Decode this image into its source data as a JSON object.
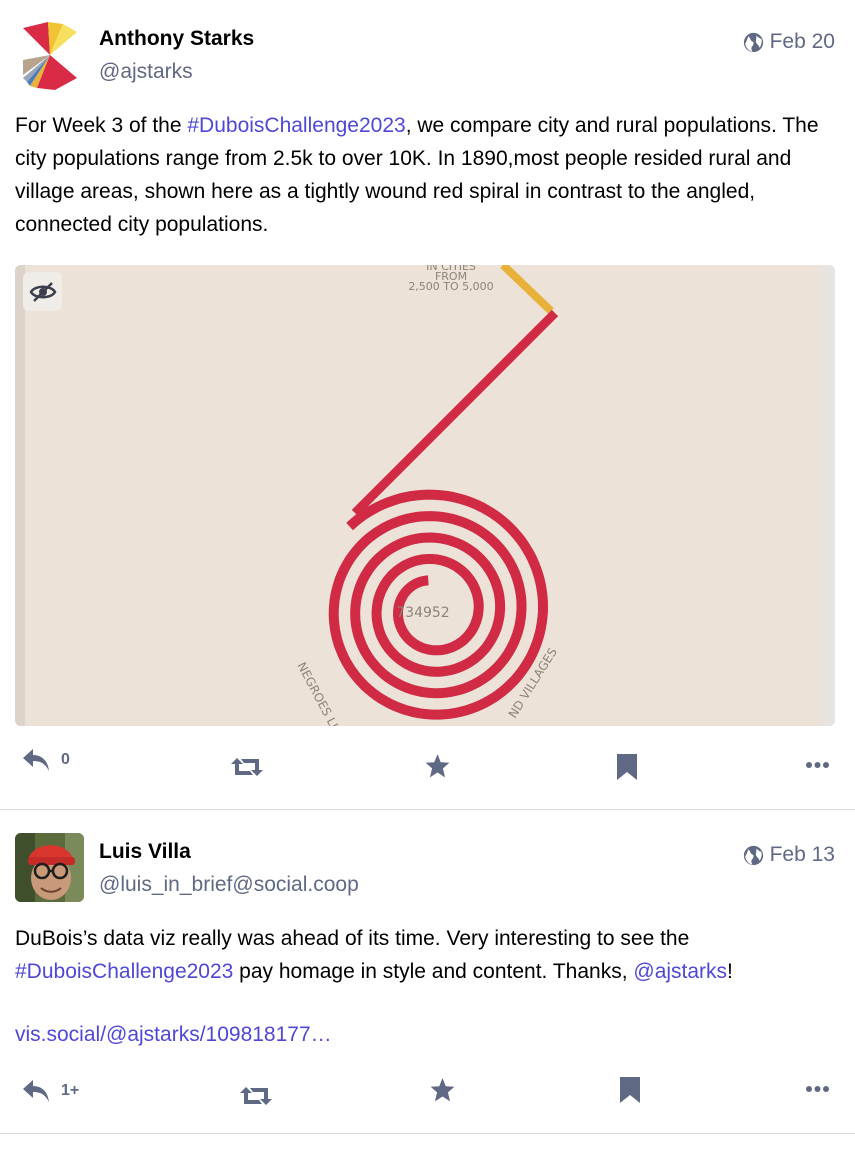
{
  "posts": [
    {
      "author": "Anthony Starks",
      "handle": "@ajstarks",
      "date": "Feb 20",
      "text_parts": [
        "For Week 3 of the ",
        "#DuboisChallenge2023",
        ", we compare city and rural populations. The city populations range from 2.5k to over 10K. In 1890,most people resided rural and village areas, shown here as a tightly wound red spiral in contrast to the angled, connected city populations."
      ],
      "media": {
        "label_top_line1": "IN CITIES",
        "label_top_line2": "FROM",
        "label_top_line3": "2,500 TO 5,000",
        "center_value": "734952",
        "arc_label_left": "NEGROES LIVI",
        "arc_label_right": "ND VILLAGES"
      },
      "actions": {
        "reply_count": "0"
      }
    },
    {
      "author": "Luis Villa",
      "handle": "@luis_in_brief@social.coop",
      "date": "Feb 13",
      "text_part1": "DuBois’s data viz really was ahead of its time. Very interesting to see the ",
      "hashtag": "#DuboisChallenge2023",
      "text_part2": " pay homage in style and content. Thanks, ",
      "mention": "@ajstarks",
      "text_part3": "!",
      "url": "vis.social/@ajstarks/109818177…",
      "actions": {
        "reply_count": "1+"
      }
    }
  ],
  "icons": {
    "globe": "globe-icon",
    "reply": "reply-icon",
    "boost": "boost-icon",
    "favourite": "star-icon",
    "bookmark": "bookmark-icon",
    "more": "more-icon",
    "hide": "eye-slash-icon"
  },
  "colors": {
    "link": "#4f47d6",
    "muted": "#606984",
    "spiral_red": "#d02a44",
    "city_gold": "#e8b23a",
    "paper": "#ece2d7"
  }
}
